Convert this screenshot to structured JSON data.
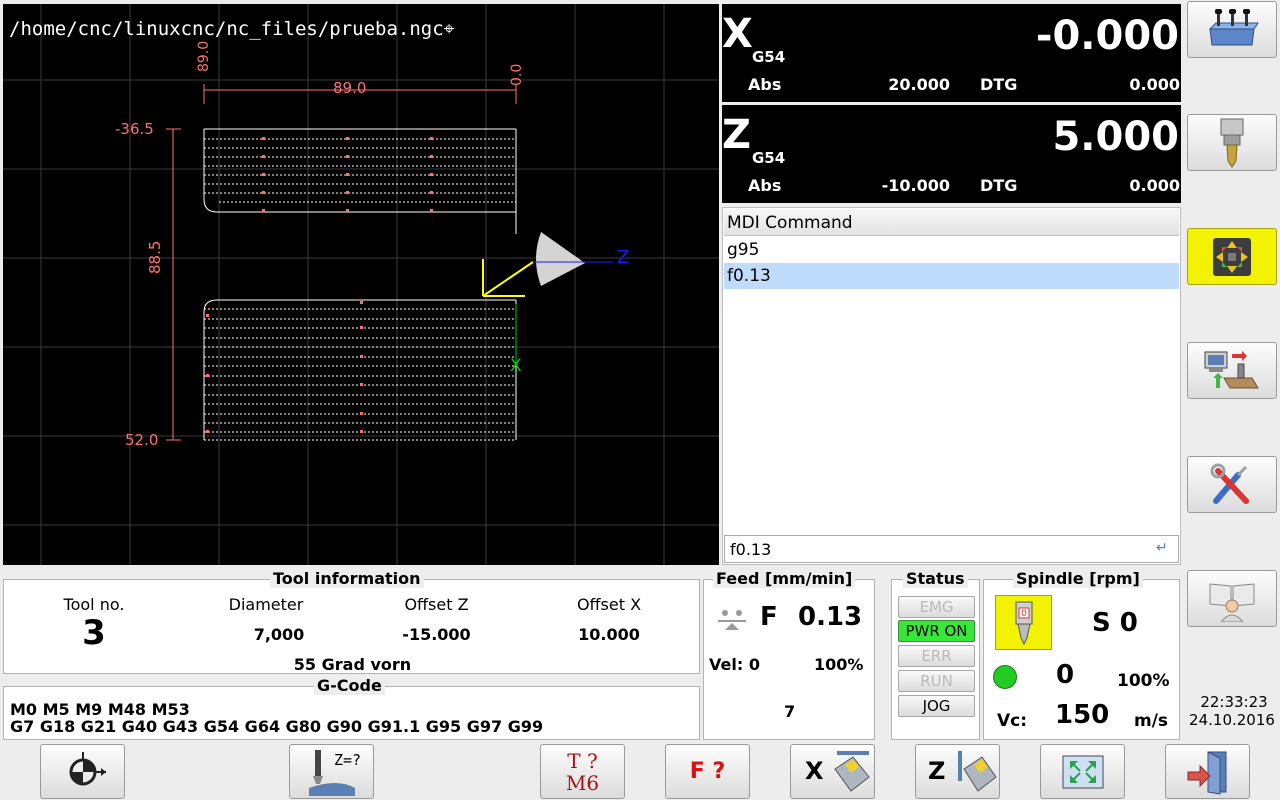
{
  "preview": {
    "file_path": "/home/cnc/linuxcnc/nc_files/prueba.ngc",
    "dim_top": "89.0",
    "dim_left": "88.5",
    "mark_89": "89.0",
    "mark_0": "0.0",
    "mark_minus365": "-36.5",
    "mark_52": "52.0",
    "axis_z": "Z",
    "axis_x": "X"
  },
  "dro": {
    "x": {
      "axis": "X",
      "coord": "G54",
      "value": "-0.000",
      "abs_label": "Abs",
      "abs_value": "20.000",
      "dtg_label": "DTG",
      "dtg_value": "0.000"
    },
    "z": {
      "axis": "Z",
      "coord": "G54",
      "value": "5.000",
      "abs_label": "Abs",
      "abs_value": "-10.000",
      "dtg_label": "DTG",
      "dtg_value": "0.000"
    }
  },
  "mdi": {
    "header": "MDI Command",
    "history": [
      "g95",
      "f0.13"
    ],
    "selected_index": 1,
    "input_value": "f0.13"
  },
  "right_toolbar": [
    {
      "name": "machine-home-icon",
      "active": false
    },
    {
      "name": "tool-spindle-icon",
      "active": false
    },
    {
      "name": "jog-arrows-icon",
      "active": true
    },
    {
      "name": "program-transfer-icon",
      "active": false
    },
    {
      "name": "settings-tools-icon",
      "active": false
    },
    {
      "name": "user-manual-icon",
      "active": false
    }
  ],
  "tool_info": {
    "title": "Tool information",
    "tool_no_label": "Tool no.",
    "tool_no": "3",
    "diameter_label": "Diameter",
    "diameter": "7,000",
    "offset_z_label": "Offset Z",
    "offset_z": "-15.000",
    "offset_x_label": "Offset X",
    "offset_x": "10.000",
    "description": "55 Grad vorn"
  },
  "gcode": {
    "title": "G-Code",
    "line1": "M0 M5 M9 M48 M53",
    "line2": "G7 G18 G21 G40 G43 G54 G64 G80 G90 G91.1 G95 G97 G99"
  },
  "feed": {
    "title": "Feed [mm/min]",
    "letter": "F",
    "value": "0.13",
    "vel_label": "Vel: 0",
    "override": "100%",
    "line": "7"
  },
  "status": {
    "title": "Status",
    "buttons": [
      "EMG",
      "PWR ON",
      "ERR",
      "RUN",
      "JOG"
    ]
  },
  "spindle": {
    "title": "Spindle [rpm]",
    "s_label": "S 0",
    "speed": "0",
    "override": "100%",
    "vc_label": "Vc:",
    "vc_value": "150",
    "vc_unit": "m/s"
  },
  "clock": {
    "time": "22:33:23",
    "date": "24.10.2016"
  },
  "bottom_toolbar": {
    "zprobe_label": "Z=?",
    "tool_change_top": "T ?",
    "tool_change_bottom": "M6",
    "feed_label": "F ?",
    "touch_x_label": "X",
    "touch_z_label": "Z"
  },
  "colors": {
    "preview_bg": "#000000",
    "path": "#ffffff",
    "dims": "#ff6a6a",
    "tool_axes": "#ffff00",
    "z_axis": "#1a1aff",
    "x_axis": "#00c800",
    "active": "#f3f200",
    "pwr_on": "#38e838",
    "selected_row": "#bfdcfc"
  }
}
